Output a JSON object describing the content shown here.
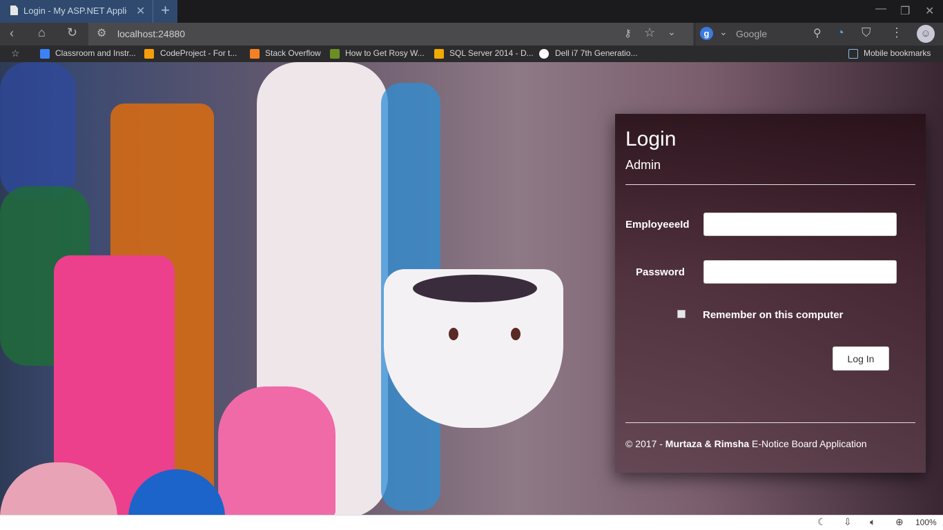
{
  "browser": {
    "tab_title": "Login - My ASP.NET Application",
    "new_tab_symbol": "+",
    "close_symbol": "✕",
    "url": "localhost:24880",
    "search_engine": "Google",
    "zoom": "100%"
  },
  "bookmarks": [
    {
      "label": "Classroom and Instr...",
      "icon": "classroom-icon",
      "color": "#3b82f6"
    },
    {
      "label": "CodeProject - For t...",
      "icon": "codeproject-icon",
      "color": "#f59e0b"
    },
    {
      "label": "Stack Overflow",
      "icon": "stackoverflow-icon",
      "color": "#f48024"
    },
    {
      "label": "How to Get Rosy W...",
      "icon": "site-icon",
      "color": "#6b8e23"
    },
    {
      "label": "SQL Server 2014 - D...",
      "icon": "sqlserver-icon",
      "color": "#f2a900"
    },
    {
      "label": "Dell i7 7th Generatio...",
      "icon": "olx-icon",
      "color": "#ffffff"
    }
  ],
  "mobile_bookmarks": "Mobile bookmarks",
  "login": {
    "title": "Login",
    "subtitle": "Admin",
    "employee_label": "EmployeeeId",
    "password_label": "Password",
    "remember_label": "Remember on this computer",
    "login_button": "Log In",
    "footer_prefix": "© 2017 - ",
    "footer_authors": "Murtaza & Rimsha",
    "footer_suffix": " E-Notice Board Application"
  },
  "colors": {
    "tab_active": "#2f4a6e",
    "panel": "#4a2a36"
  }
}
